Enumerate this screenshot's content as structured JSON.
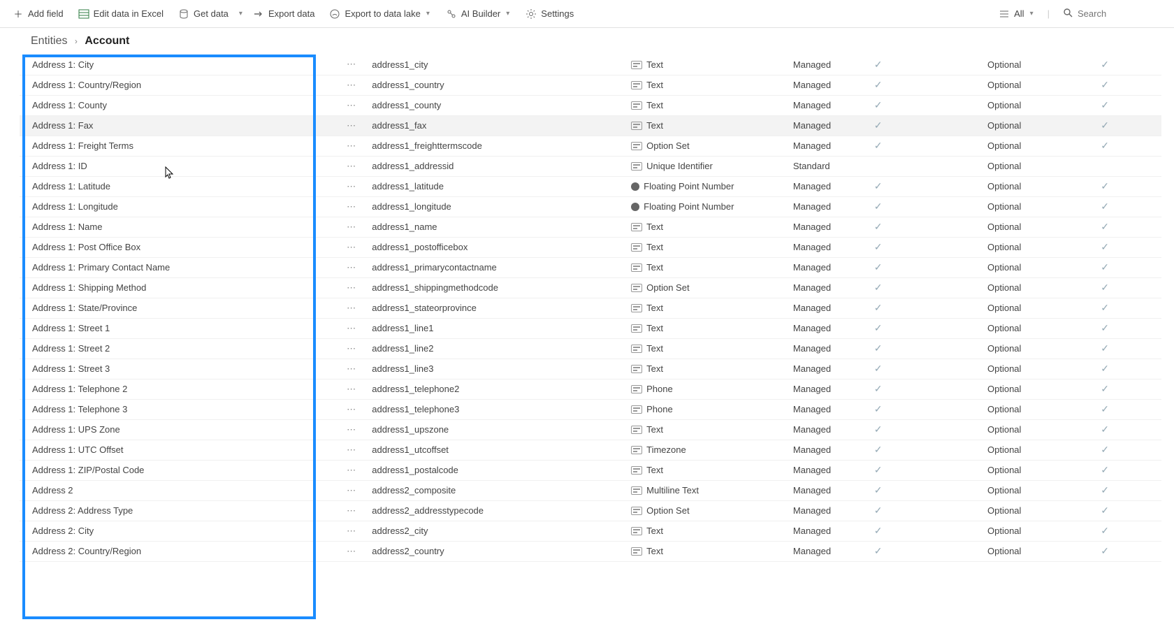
{
  "toolbar": {
    "addField": "Add field",
    "editExcel": "Edit data in Excel",
    "getData": "Get data",
    "exportData": "Export data",
    "exportLake": "Export to data lake",
    "aiBuilder": "AI Builder",
    "settings": "Settings",
    "viewAll": "All",
    "searchPlaceholder": "Search"
  },
  "breadcrumb": {
    "root": "Entities",
    "current": "Account"
  },
  "rows": [
    {
      "display": "Address 1: City",
      "name": "address1_city",
      "type": "Text",
      "managed": "Managed",
      "cust": true,
      "required": "Optional",
      "search": true
    },
    {
      "display": "Address 1: Country/Region",
      "name": "address1_country",
      "type": "Text",
      "managed": "Managed",
      "cust": true,
      "required": "Optional",
      "search": true
    },
    {
      "display": "Address 1: County",
      "name": "address1_county",
      "type": "Text",
      "managed": "Managed",
      "cust": true,
      "required": "Optional",
      "search": true
    },
    {
      "display": "Address 1: Fax",
      "name": "address1_fax",
      "type": "Text",
      "managed": "Managed",
      "cust": true,
      "required": "Optional",
      "search": true,
      "hovered": true
    },
    {
      "display": "Address 1: Freight Terms",
      "name": "address1_freighttermscode",
      "type": "Option Set",
      "managed": "Managed",
      "cust": true,
      "required": "Optional",
      "search": true
    },
    {
      "display": "Address 1: ID",
      "name": "address1_addressid",
      "type": "Unique Identifier",
      "managed": "Standard",
      "cust": false,
      "required": "Optional",
      "search": false
    },
    {
      "display": "Address 1: Latitude",
      "name": "address1_latitude",
      "type": "Floating Point Number",
      "typeIco": "float",
      "managed": "Managed",
      "cust": true,
      "required": "Optional",
      "search": true
    },
    {
      "display": "Address 1: Longitude",
      "name": "address1_longitude",
      "type": "Floating Point Number",
      "typeIco": "float",
      "managed": "Managed",
      "cust": true,
      "required": "Optional",
      "search": true
    },
    {
      "display": "Address 1: Name",
      "name": "address1_name",
      "type": "Text",
      "managed": "Managed",
      "cust": true,
      "required": "Optional",
      "search": true
    },
    {
      "display": "Address 1: Post Office Box",
      "name": "address1_postofficebox",
      "type": "Text",
      "managed": "Managed",
      "cust": true,
      "required": "Optional",
      "search": true
    },
    {
      "display": "Address 1: Primary Contact Name",
      "name": "address1_primarycontactname",
      "type": "Text",
      "managed": "Managed",
      "cust": true,
      "required": "Optional",
      "search": true
    },
    {
      "display": "Address 1: Shipping Method",
      "name": "address1_shippingmethodcode",
      "type": "Option Set",
      "managed": "Managed",
      "cust": true,
      "required": "Optional",
      "search": true
    },
    {
      "display": "Address 1: State/Province",
      "name": "address1_stateorprovince",
      "type": "Text",
      "managed": "Managed",
      "cust": true,
      "required": "Optional",
      "search": true
    },
    {
      "display": "Address 1: Street 1",
      "name": "address1_line1",
      "type": "Text",
      "managed": "Managed",
      "cust": true,
      "required": "Optional",
      "search": true
    },
    {
      "display": "Address 1: Street 2",
      "name": "address1_line2",
      "type": "Text",
      "managed": "Managed",
      "cust": true,
      "required": "Optional",
      "search": true
    },
    {
      "display": "Address 1: Street 3",
      "name": "address1_line3",
      "type": "Text",
      "managed": "Managed",
      "cust": true,
      "required": "Optional",
      "search": true
    },
    {
      "display": "Address 1: Telephone 2",
      "name": "address1_telephone2",
      "type": "Phone",
      "managed": "Managed",
      "cust": true,
      "required": "Optional",
      "search": true
    },
    {
      "display": "Address 1: Telephone 3",
      "name": "address1_telephone3",
      "type": "Phone",
      "managed": "Managed",
      "cust": true,
      "required": "Optional",
      "search": true
    },
    {
      "display": "Address 1: UPS Zone",
      "name": "address1_upszone",
      "type": "Text",
      "managed": "Managed",
      "cust": true,
      "required": "Optional",
      "search": true
    },
    {
      "display": "Address 1: UTC Offset",
      "name": "address1_utcoffset",
      "type": "Timezone",
      "managed": "Managed",
      "cust": true,
      "required": "Optional",
      "search": true
    },
    {
      "display": "Address 1: ZIP/Postal Code",
      "name": "address1_postalcode",
      "type": "Text",
      "managed": "Managed",
      "cust": true,
      "required": "Optional",
      "search": true
    },
    {
      "display": "Address 2",
      "name": "address2_composite",
      "type": "Multiline Text",
      "managed": "Managed",
      "cust": true,
      "required": "Optional",
      "search": true
    },
    {
      "display": "Address 2: Address Type",
      "name": "address2_addresstypecode",
      "type": "Option Set",
      "managed": "Managed",
      "cust": true,
      "required": "Optional",
      "search": true
    },
    {
      "display": "Address 2: City",
      "name": "address2_city",
      "type": "Text",
      "managed": "Managed",
      "cust": true,
      "required": "Optional",
      "search": true
    },
    {
      "display": "Address 2: Country/Region",
      "name": "address2_country",
      "type": "Text",
      "managed": "Managed",
      "cust": true,
      "required": "Optional",
      "search": true
    }
  ]
}
